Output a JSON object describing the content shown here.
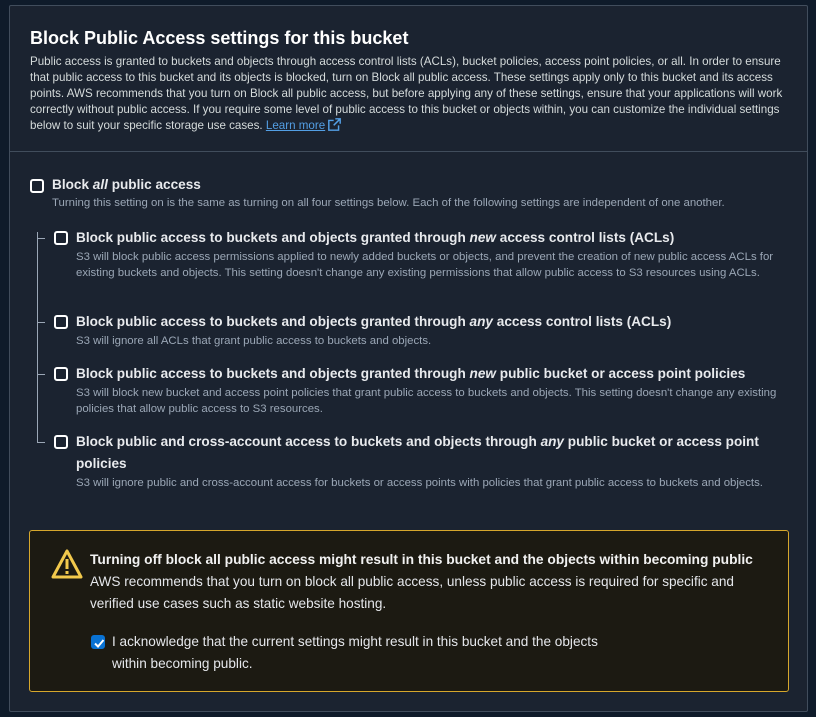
{
  "header": {
    "title": "Block Public Access settings for this bucket",
    "description": "Public access is granted to buckets and objects through access control lists (ACLs), bucket policies, access point policies, or all. In order to ensure that public access to this bucket and its objects is blocked, turn on Block all public access. These settings apply only to this bucket and its access points. AWS recommends that you turn on Block all public access, but before applying any of these settings, ensure that your applications will work correctly without public access. If you require some level of public access to this bucket or objects within, you can customize the individual settings below to suit your specific storage use cases.",
    "learn_more": "Learn more"
  },
  "block_all": {
    "title_pre": "Block ",
    "title_em": "all",
    "title_post": " public access",
    "description": "Turning this setting on is the same as turning on all four settings below. Each of the following settings are independent of one another.",
    "checked": false
  },
  "options": [
    {
      "title_pre": "Block public access to buckets and objects granted through ",
      "title_em": "new",
      "title_post": " access control lists (ACLs)",
      "description": "S3 will block public access permissions applied to newly added buckets or objects, and prevent the creation of new public access ACLs for existing buckets and objects. This setting doesn't change any existing permissions that allow public access to S3 resources using ACLs.",
      "checked": false
    },
    {
      "title_pre": "Block public access to buckets and objects granted through ",
      "title_em": "any",
      "title_post": " access control lists (ACLs)",
      "description": "S3 will ignore all ACLs that grant public access to buckets and objects.",
      "checked": false
    },
    {
      "title_pre": "Block public access to buckets and objects granted through ",
      "title_em": "new",
      "title_post": " public bucket or access point policies",
      "description": "S3 will block new bucket and access point policies that grant public access to buckets and objects. This setting doesn't change any existing policies that allow public access to S3 resources.",
      "checked": false
    },
    {
      "title_pre": "Block public and cross-account access to buckets and objects through ",
      "title_em": "any",
      "title_post": " public bucket or access point policies",
      "description": "S3 will ignore public and cross-account access for buckets or access points with policies that grant public access to buckets and objects.",
      "checked": false
    }
  ],
  "warning": {
    "title": "Turning off block all public access might result in this bucket and the objects within becoming public",
    "text": "AWS recommends that you turn on block all public access, unless public access is required for specific and verified use cases such as static website hosting.",
    "acknowledge": "I acknowledge that the current settings might result in this bucket and the objects within becoming public.",
    "acknowledged": true
  },
  "colors": {
    "accent": "#0972d3",
    "link": "#539fe5",
    "warning_border": "#d6a72c"
  }
}
